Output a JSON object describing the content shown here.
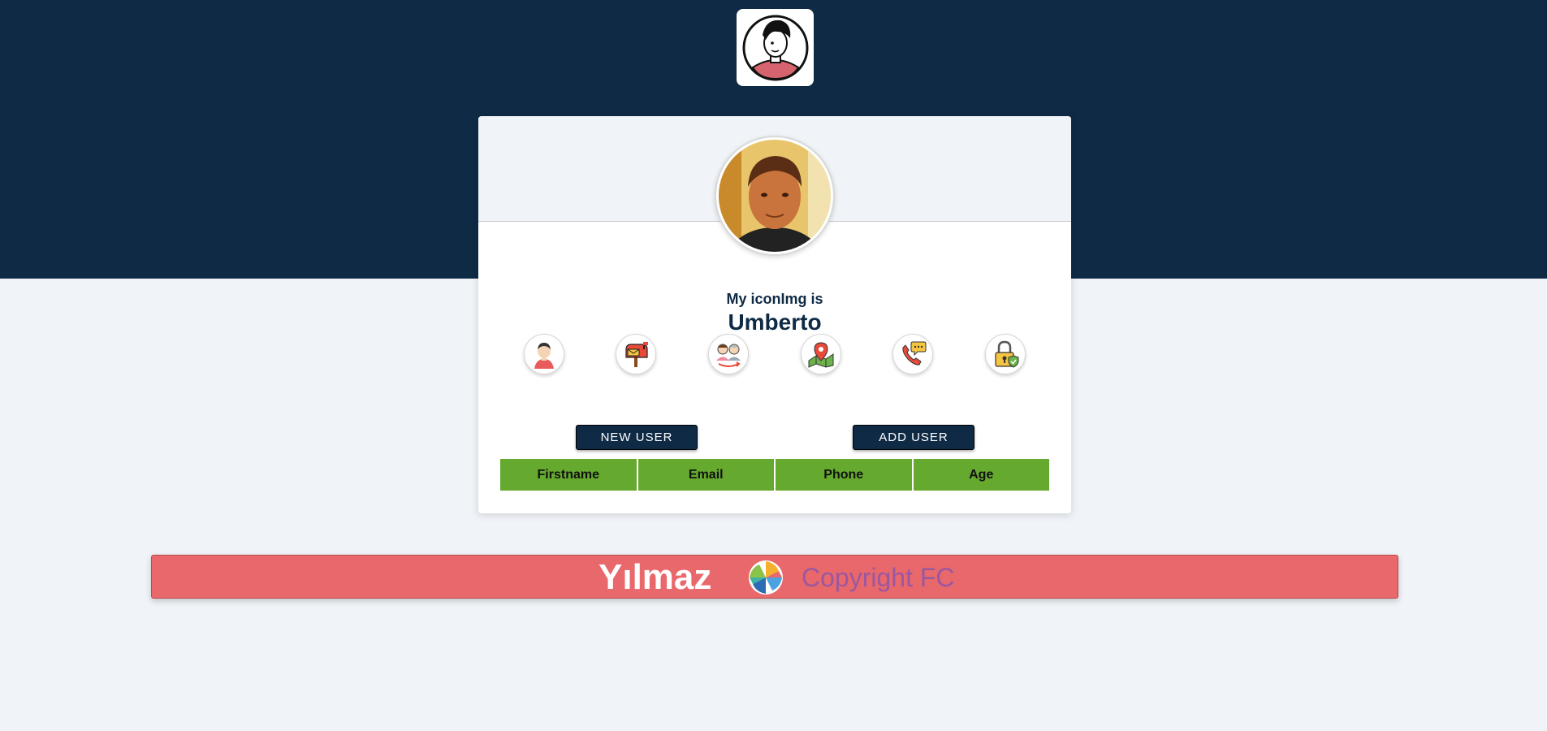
{
  "label": {
    "title": "My iconImg is",
    "value": "Umberto"
  },
  "info_icons": [
    {
      "name": "user-icon"
    },
    {
      "name": "mailbox-icon"
    },
    {
      "name": "age-icon"
    },
    {
      "name": "location-icon"
    },
    {
      "name": "phone-icon"
    },
    {
      "name": "lock-icon"
    }
  ],
  "buttons": {
    "new_user": "NEW USER",
    "add_user": "ADD USER"
  },
  "table": {
    "headers": [
      "Firstname",
      "Email",
      "Phone",
      "Age"
    ]
  },
  "footer": {
    "brand": "Yılmaz",
    "copyright": "Copyright FC"
  },
  "colors": {
    "navy": "#0f2a45",
    "page_bg": "#f0f4f8",
    "table_header": "#65a92e",
    "footer_bg": "#e8686b",
    "footer_copy": "#9a57a0"
  }
}
